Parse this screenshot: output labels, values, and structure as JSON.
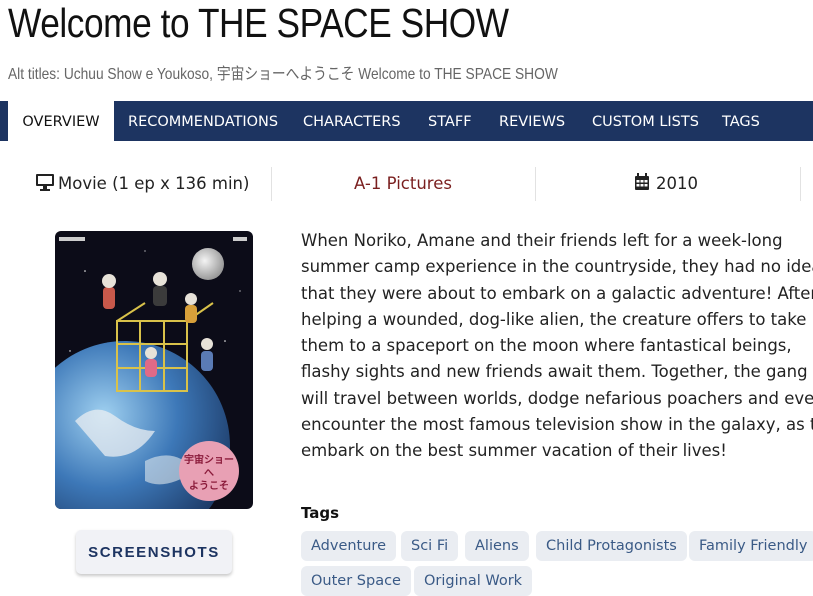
{
  "title": "Welcome to THE SPACE SHOW",
  "alt_titles": "Alt titles: Uchuu Show e Youkoso, 宇宙ショーへようこそ Welcome to THE SPACE SHOW",
  "nav": [
    "OVERVIEW",
    "RECOMMENDATIONS",
    "CHARACTERS",
    "STAFF",
    "REVIEWS",
    "CUSTOM LISTS",
    "TAGS"
  ],
  "info": {
    "format": "Movie (1 ep x 136 min)",
    "format_icon": "monitor-icon",
    "studio": "A-1 Pictures",
    "studio_color": "#7a1f1f",
    "year": "2010",
    "year_icon": "calendar-icon"
  },
  "screenshots_label": "SCREENSHOTS",
  "synopsis_lines": [
    "When Noriko, Amane and their friends left for a week-long",
    "summer camp experience in the countryside, they had no idea",
    "that they were about to embark on a galactic adventure! After",
    "helping a wounded, dog-like alien, the creature offers to take",
    "them to a spaceport on the moon where fantastical beings,",
    "flashy sights and new friends await them. Together, the gang",
    "will travel between worlds, dodge nefarious poachers and even",
    "encounter the most famous television show in the galaxy, as they",
    "embark on the best summer vacation of their lives!"
  ],
  "tags_label": "Tags",
  "tags": [
    "Adventure",
    "Sci Fi",
    "Aliens",
    "Child Protagonists",
    "Family Friendly",
    "Outer Space",
    "Original Work"
  ],
  "colors": {
    "nav_bg": "#1d3461",
    "tag_bg": "#eaedf2",
    "tag_text": "#3a5a86"
  }
}
